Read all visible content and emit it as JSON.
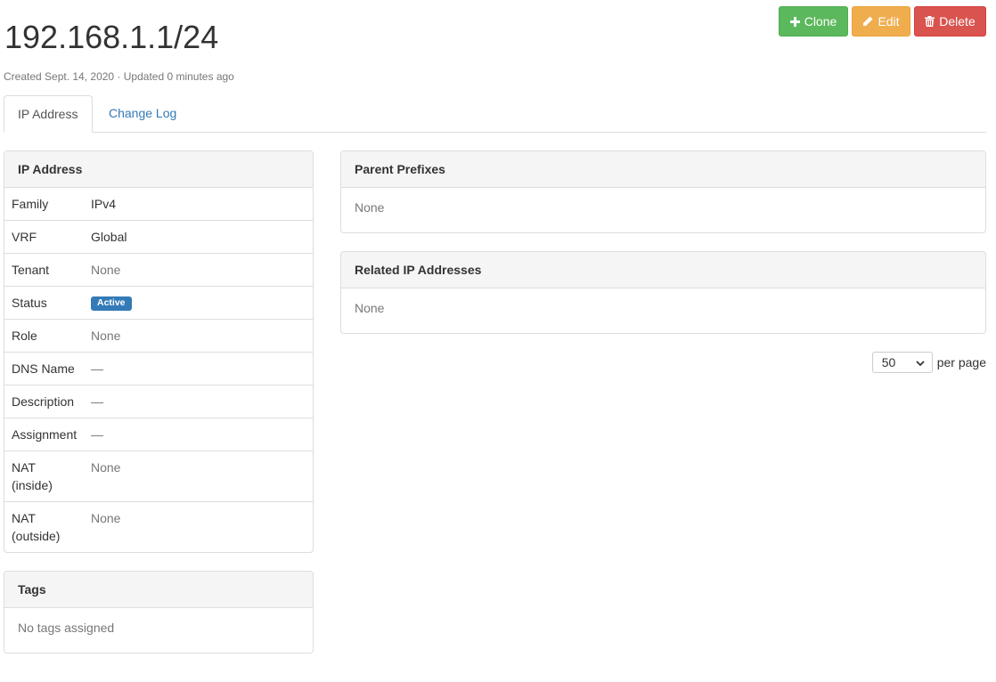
{
  "header": {
    "title": "192.168.1.1/24",
    "meta": "Created Sept. 14, 2020 · Updated 0 minutes ago"
  },
  "actions": {
    "clone_label": "Clone",
    "edit_label": "Edit",
    "delete_label": "Delete"
  },
  "tabs": [
    {
      "label": "IP Address"
    },
    {
      "label": "Change Log"
    }
  ],
  "ip_panel": {
    "heading": "IP Address",
    "rows": [
      {
        "key": "Family",
        "value": "IPv4"
      },
      {
        "key": "VRF",
        "value": "Global"
      },
      {
        "key": "Tenant",
        "value": "None"
      },
      {
        "key": "Status",
        "value": "Active"
      },
      {
        "key": "Role",
        "value": "None"
      },
      {
        "key": "DNS Name",
        "value": "—"
      },
      {
        "key": "Description",
        "value": "—"
      },
      {
        "key": "Assignment",
        "value": "—"
      },
      {
        "key": "NAT\n(inside)",
        "value": "None"
      },
      {
        "key": "NAT\n(outside)",
        "value": "None"
      }
    ]
  },
  "tags_panel": {
    "heading": "Tags",
    "body": "No tags assigned"
  },
  "parent_prefixes": {
    "heading": "Parent Prefixes",
    "body": "None"
  },
  "related_ips": {
    "heading": "Related IP Addresses",
    "body": "None"
  },
  "pagination": {
    "per_page_value": "50",
    "per_page_label": "per page"
  },
  "colors": {
    "success": "#5cb85c",
    "warning": "#f0ad4e",
    "danger": "#d9534f",
    "primary": "#337ab7"
  }
}
